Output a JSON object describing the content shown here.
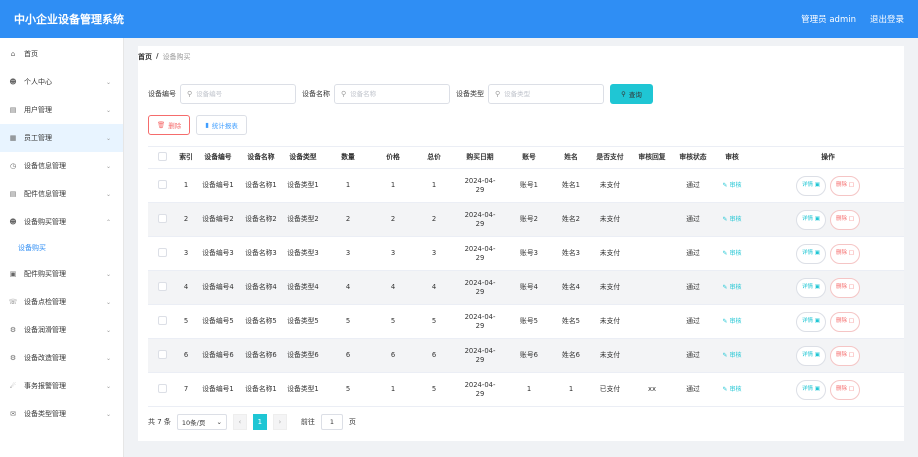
{
  "app": {
    "title": "中小企业设备管理系统",
    "user": "管理员 admin",
    "logout": "退出登录"
  },
  "sidebar": {
    "items": [
      {
        "label": "首页",
        "icon": "home-icon",
        "chevron": false
      },
      {
        "label": "个人中心",
        "icon": "user-icon",
        "chevron": true
      },
      {
        "label": "用户管理",
        "icon": "chat-icon",
        "chevron": true
      },
      {
        "label": "员工管理",
        "icon": "grid-icon",
        "chevron": true,
        "active": true
      },
      {
        "label": "设备信息管理",
        "icon": "clock-icon",
        "chevron": true
      },
      {
        "label": "配件信息管理",
        "icon": "document-icon",
        "chevron": true
      },
      {
        "label": "设备购买管理",
        "icon": "user-icon",
        "chevron": true,
        "expanded": true
      }
    ],
    "sub_item": "设备购买",
    "items_after": [
      {
        "label": "配件购买管理",
        "icon": "chart-icon",
        "chevron": true
      },
      {
        "label": "设备点检管理",
        "icon": "phone-icon",
        "chevron": true
      },
      {
        "label": "设备润滑管理",
        "icon": "gear-icon",
        "chevron": true
      },
      {
        "label": "设备改造管理",
        "icon": "gear-icon",
        "chevron": true
      },
      {
        "label": "事务报警管理",
        "icon": "bell-icon",
        "chevron": true
      },
      {
        "label": "设备类型管理",
        "icon": "mail-icon",
        "chevron": true
      }
    ]
  },
  "breadcrumb": {
    "home": "首页",
    "sep": "/",
    "current": "设备购买"
  },
  "filters": {
    "f1_label": "设备编号",
    "f1_placeholder": "设备编号",
    "f2_label": "设备名称",
    "f2_placeholder": "设备名称",
    "f3_label": "设备类型",
    "f3_placeholder": "设备类型",
    "search": "查询"
  },
  "actions": {
    "delete": "删除",
    "stats": "统计报表"
  },
  "table": {
    "headers": [
      "索引",
      "设备编号",
      "设备名称",
      "设备类型",
      "数量",
      "价格",
      "总价",
      "购买日期",
      "账号",
      "姓名",
      "是否支付",
      "审核回复",
      "审核状态",
      "审核",
      "操作"
    ],
    "audit_label": "审核",
    "detail_label": "详情",
    "delete_label": "删除",
    "rows": [
      [
        "1",
        "设备编号1",
        "设备名称1",
        "设备类型1",
        "1",
        "1",
        "1",
        [
          "2024-04-",
          "29"
        ],
        "账号1",
        "姓名1",
        "未支付",
        "",
        "通过"
      ],
      [
        "2",
        "设备编号2",
        "设备名称2",
        "设备类型2",
        "2",
        "2",
        "2",
        [
          "2024-04-",
          "29"
        ],
        "账号2",
        "姓名2",
        "未支付",
        "",
        "通过"
      ],
      [
        "3",
        "设备编号3",
        "设备名称3",
        "设备类型3",
        "3",
        "3",
        "3",
        [
          "2024-04-",
          "29"
        ],
        "账号3",
        "姓名3",
        "未支付",
        "",
        "通过"
      ],
      [
        "4",
        "设备编号4",
        "设备名称4",
        "设备类型4",
        "4",
        "4",
        "4",
        [
          "2024-04-",
          "29"
        ],
        "账号4",
        "姓名4",
        "未支付",
        "",
        "通过"
      ],
      [
        "5",
        "设备编号5",
        "设备名称5",
        "设备类型5",
        "5",
        "5",
        "5",
        [
          "2024-04-",
          "29"
        ],
        "账号5",
        "姓名5",
        "未支付",
        "",
        "通过"
      ],
      [
        "6",
        "设备编号6",
        "设备名称6",
        "设备类型6",
        "6",
        "6",
        "6",
        [
          "2024-04-",
          "29"
        ],
        "账号6",
        "姓名6",
        "未支付",
        "",
        "通过"
      ],
      [
        "7",
        "设备编号1",
        "设备名称1",
        "设备类型1",
        "5",
        "1",
        "5",
        [
          "2024-04-",
          "29"
        ],
        "1",
        "1",
        "已支付",
        "xx",
        "通过"
      ]
    ]
  },
  "pager": {
    "total": "共 7 条",
    "size": "10条/页",
    "page": "1",
    "goto": "前往",
    "goto_value": "1",
    "page_unit": "页"
  }
}
